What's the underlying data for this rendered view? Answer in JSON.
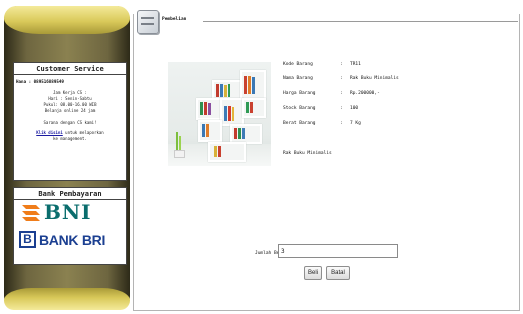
{
  "sidebar": {
    "customer_service": {
      "title": "Customer Service",
      "phone": "Hana : 089516889549",
      "hours": [
        "Jam Kerja CS :",
        "Hari : Senin-Sabtu",
        "Pukul: 08.00-16.00 WIB",
        "Belanja online 24 jam"
      ],
      "thanks": "Sarana dengan CS kami!",
      "report_link": "Klik disini",
      "report_rest": " untuk melaporkan",
      "report_line2": "ke management."
    },
    "bank": {
      "title": "Bank Pembayaran",
      "bni_logo": "BNI",
      "bri_logo": "BANK BRI",
      "bri_mark": "B"
    }
  },
  "page": {
    "tab_title": "Pembelian",
    "tab_icon": "bookshelf-icon"
  },
  "product": {
    "fields": [
      {
        "label": "Kode Barang",
        "value": "TR11"
      },
      {
        "label": "Nama Barang",
        "value": "Rak Buku Minimalis"
      },
      {
        "label": "Harga Barang",
        "value": "Rp.200000,-"
      },
      {
        "label": "Stock Barang",
        "value": "100"
      },
      {
        "label": "Berat Barang",
        "value": "7 Kg"
      }
    ],
    "separator": ":",
    "description": "Rak Buku Minimalis"
  },
  "purchase": {
    "qty_label": "Jumlah Beli :",
    "qty_value": "3",
    "buy_label": "Beli",
    "cancel_label": "Batal"
  },
  "colors": {
    "sidebar_gold": "#d9c95a",
    "sidebar_dark": "#6e6640",
    "bni_teal": "#0a6d6d",
    "bni_orange": "#f07d1a",
    "bri_blue": "#1b3f91"
  }
}
